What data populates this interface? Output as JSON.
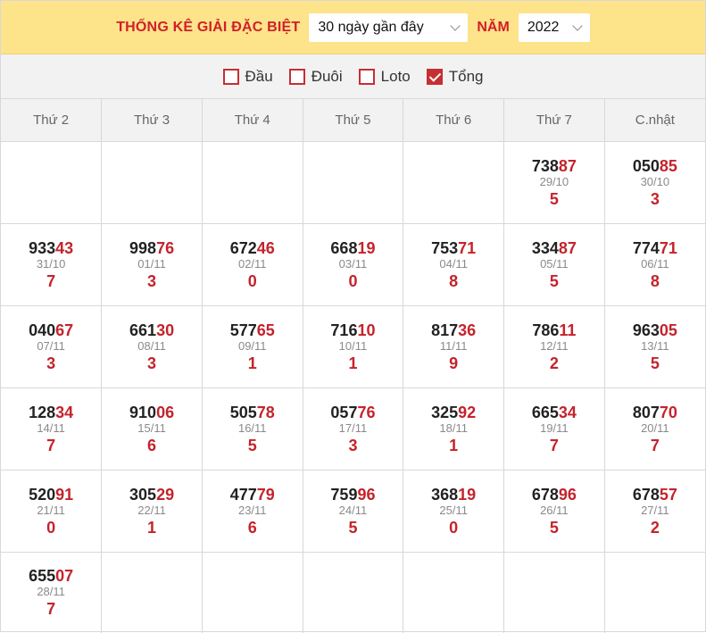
{
  "header": {
    "title": "THỐNG KÊ GIẢI ĐẶC BIỆT",
    "range_select": "30 ngày gần đây",
    "year_label": "NĂM",
    "year_select": "2022"
  },
  "filters": [
    {
      "label": "Đầu",
      "checked": false
    },
    {
      "label": "Đuôi",
      "checked": false
    },
    {
      "label": "Loto",
      "checked": false
    },
    {
      "label": "Tổng",
      "checked": true
    }
  ],
  "colors": {
    "accent": "#c4232b",
    "header_bg": "#fde38a",
    "filter_bg": "#f2f2f2"
  },
  "table": {
    "columns": [
      "Thứ 2",
      "Thứ 3",
      "Thứ 4",
      "Thứ 5",
      "Thứ 6",
      "Thứ 7",
      "C.nhật"
    ],
    "rows": [
      [
        null,
        null,
        null,
        null,
        null,
        {
          "head": "738",
          "tail": "87",
          "date": "29/10",
          "sum": "5"
        },
        {
          "head": "050",
          "tail": "85",
          "date": "30/10",
          "sum": "3"
        }
      ],
      [
        {
          "head": "933",
          "tail": "43",
          "date": "31/10",
          "sum": "7"
        },
        {
          "head": "998",
          "tail": "76",
          "date": "01/11",
          "sum": "3"
        },
        {
          "head": "672",
          "tail": "46",
          "date": "02/11",
          "sum": "0"
        },
        {
          "head": "668",
          "tail": "19",
          "date": "03/11",
          "sum": "0"
        },
        {
          "head": "753",
          "tail": "71",
          "date": "04/11",
          "sum": "8"
        },
        {
          "head": "334",
          "tail": "87",
          "date": "05/11",
          "sum": "5"
        },
        {
          "head": "774",
          "tail": "71",
          "date": "06/11",
          "sum": "8"
        }
      ],
      [
        {
          "head": "040",
          "tail": "67",
          "date": "07/11",
          "sum": "3"
        },
        {
          "head": "661",
          "tail": "30",
          "date": "08/11",
          "sum": "3"
        },
        {
          "head": "577",
          "tail": "65",
          "date": "09/11",
          "sum": "1"
        },
        {
          "head": "716",
          "tail": "10",
          "date": "10/11",
          "sum": "1"
        },
        {
          "head": "817",
          "tail": "36",
          "date": "11/11",
          "sum": "9"
        },
        {
          "head": "786",
          "tail": "11",
          "date": "12/11",
          "sum": "2"
        },
        {
          "head": "963",
          "tail": "05",
          "date": "13/11",
          "sum": "5"
        }
      ],
      [
        {
          "head": "128",
          "tail": "34",
          "date": "14/11",
          "sum": "7"
        },
        {
          "head": "910",
          "tail": "06",
          "date": "15/11",
          "sum": "6"
        },
        {
          "head": "505",
          "tail": "78",
          "date": "16/11",
          "sum": "5"
        },
        {
          "head": "057",
          "tail": "76",
          "date": "17/11",
          "sum": "3"
        },
        {
          "head": "325",
          "tail": "92",
          "date": "18/11",
          "sum": "1"
        },
        {
          "head": "665",
          "tail": "34",
          "date": "19/11",
          "sum": "7"
        },
        {
          "head": "807",
          "tail": "70",
          "date": "20/11",
          "sum": "7"
        }
      ],
      [
        {
          "head": "520",
          "tail": "91",
          "date": "21/11",
          "sum": "0"
        },
        {
          "head": "305",
          "tail": "29",
          "date": "22/11",
          "sum": "1"
        },
        {
          "head": "477",
          "tail": "79",
          "date": "23/11",
          "sum": "6"
        },
        {
          "head": "759",
          "tail": "96",
          "date": "24/11",
          "sum": "5"
        },
        {
          "head": "368",
          "tail": "19",
          "date": "25/11",
          "sum": "0"
        },
        {
          "head": "678",
          "tail": "96",
          "date": "26/11",
          "sum": "5"
        },
        {
          "head": "678",
          "tail": "57",
          "date": "27/11",
          "sum": "2"
        }
      ],
      [
        {
          "head": "655",
          "tail": "07",
          "date": "28/11",
          "sum": "7"
        },
        null,
        null,
        null,
        null,
        null,
        null
      ]
    ]
  }
}
